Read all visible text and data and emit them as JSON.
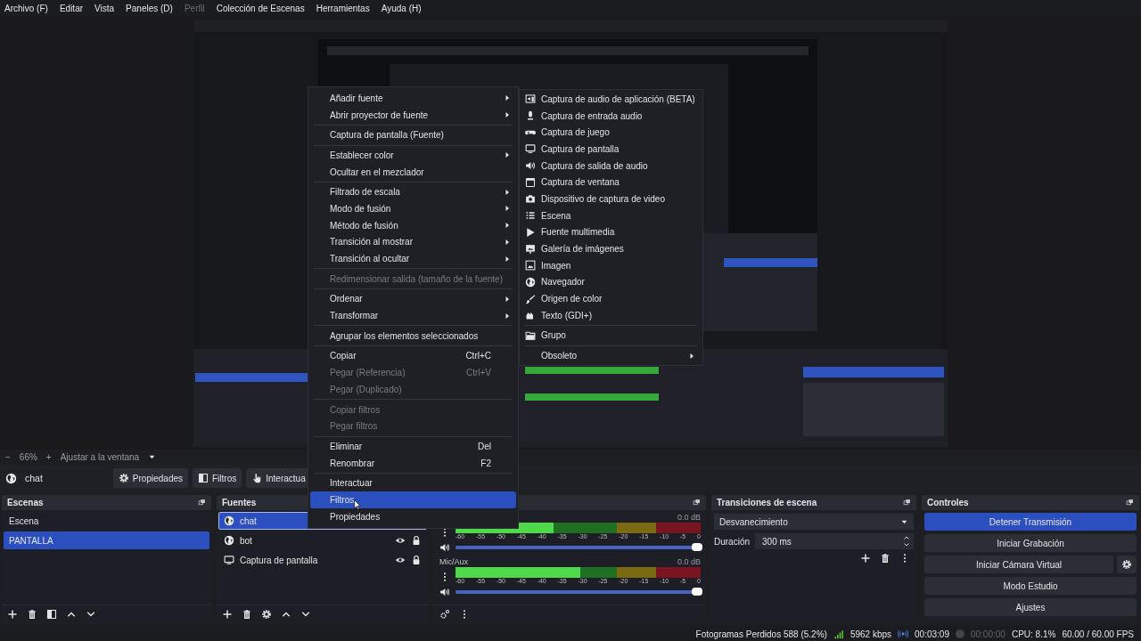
{
  "menu_bar": [
    {
      "label": "Archivo (F)",
      "disabled": false
    },
    {
      "label": "Editar",
      "disabled": false
    },
    {
      "label": "Vista",
      "disabled": false
    },
    {
      "label": "Paneles (D)",
      "disabled": false
    },
    {
      "label": "Perfil",
      "disabled": true
    },
    {
      "label": "Colección de Escenas",
      "disabled": false
    },
    {
      "label": "Herramientas",
      "disabled": false
    },
    {
      "label": "Ayuda (H)",
      "disabled": false
    }
  ],
  "zoom_bar": {
    "zoom_out": "−",
    "zoom": "66%",
    "zoom_in": "+",
    "fit": "Ajustar a la ventana"
  },
  "source_toolbar": {
    "source": "chat",
    "buttons": [
      {
        "label": "Propiedades",
        "kind": "gear"
      },
      {
        "label": "Filtros",
        "kind": "filter"
      },
      {
        "label": "Interactua",
        "kind": "hand"
      }
    ]
  },
  "scenes": {
    "title": "Escenas",
    "items": [
      {
        "label": "Escena",
        "selected": false
      },
      {
        "label": "PANTALLA",
        "selected": true
      }
    ]
  },
  "sources": {
    "title": "Fuentes",
    "items": [
      {
        "label": "chat",
        "kind": "browser",
        "selected": true
      },
      {
        "label": "bot",
        "kind": "browser",
        "selected": false,
        "visible": true,
        "locked": true
      },
      {
        "label": "Captura de pantalla",
        "kind": "display",
        "selected": false,
        "visible": true,
        "locked": true
      }
    ]
  },
  "mixer": {
    "channels": [
      {
        "reading": "0.0 dB",
        "meter": {
          "level": 0.4
        },
        "volume": {
          "level": 1
        },
        "scale": [
          "-60",
          "-55",
          "-50",
          "-45",
          "-40",
          "-35",
          "-30",
          "-25",
          "-20",
          "-15",
          "-10",
          "-5",
          "0"
        ]
      },
      {
        "name": "Mic/Aux",
        "reading": "0.0 dB",
        "meter": {
          "level": 0.51
        },
        "volume": {
          "level": 1
        },
        "scale": [
          "-60",
          "-55",
          "-50",
          "-45",
          "-40",
          "-35",
          "-30",
          "-25",
          "-20",
          "-15",
          "-10",
          "-5",
          "0"
        ]
      }
    ]
  },
  "transitions": {
    "title": "Transiciones de escena",
    "transition": "Desvanecimiento",
    "duration_label": "Duración",
    "duration": "300 ms"
  },
  "controls": {
    "title": "Controles",
    "buttons": [
      {
        "label": "Detener Transmisión",
        "active": true
      },
      {
        "label": "Iniciar Grabación",
        "active": false
      },
      {
        "label": "Iniciar Cámara Virtual",
        "active": false
      },
      {
        "label": "Modo Estudio",
        "active": false
      },
      {
        "label": "Ajustes",
        "active": false
      }
    ]
  },
  "status_bar": {
    "dropped": "Fotogramas Perdidos 588 (5.2%)",
    "bitrate": "5962 kbps",
    "stream_time": "00:03:09",
    "record_time": "00:00:00",
    "recording": false,
    "cpu": "CPU: 8.1%",
    "fps": "60.00 / 60.00 FPS"
  },
  "context_menu": {
    "groups": [
      [
        {
          "label": "Añadir fuente",
          "submenu": true,
          "disabled": false,
          "selected": false
        },
        {
          "label": "Abrir proyector de fuente",
          "submenu": true,
          "disabled": false,
          "selected": false
        }
      ],
      [
        {
          "label": "Captura de pantalla (Fuente)",
          "submenu": false,
          "disabled": false,
          "selected": false
        }
      ],
      [
        {
          "label": "Establecer color",
          "submenu": true,
          "disabled": false,
          "selected": false
        },
        {
          "label": "Ocultar en el mezclador",
          "submenu": false,
          "disabled": false,
          "selected": false
        }
      ],
      [
        {
          "label": "Filtrado de escala",
          "submenu": true,
          "disabled": false,
          "selected": false
        },
        {
          "label": "Modo de fusión",
          "submenu": true,
          "disabled": false,
          "selected": false
        },
        {
          "label": "Método de fusión",
          "submenu": true,
          "disabled": false,
          "selected": false
        },
        {
          "label": "Transición al mostrar",
          "submenu": true,
          "disabled": false,
          "selected": false
        },
        {
          "label": "Transición al ocultar",
          "submenu": true,
          "disabled": false,
          "selected": false
        }
      ],
      [
        {
          "label": "Redimensionar salida (tamaño de la fuente)",
          "submenu": false,
          "disabled": true,
          "selected": false
        }
      ],
      [
        {
          "label": "Ordenar",
          "submenu": true,
          "disabled": false,
          "selected": false
        },
        {
          "label": "Transformar",
          "submenu": true,
          "disabled": false,
          "selected": false
        }
      ],
      [
        {
          "label": "Agrupar los elementos seleccionados",
          "submenu": false,
          "disabled": false,
          "selected": false
        }
      ],
      [
        {
          "label": "Copiar",
          "shortcut": "Ctrl+C",
          "submenu": false,
          "disabled": false,
          "selected": false
        },
        {
          "label": "Pegar (Referencia)",
          "shortcut": "Ctrl+V",
          "submenu": false,
          "disabled": true,
          "selected": false
        },
        {
          "label": "Pegar (Duplicado)",
          "submenu": false,
          "disabled": true,
          "selected": false
        }
      ],
      [
        {
          "label": "Copiar filtros",
          "submenu": false,
          "disabled": true,
          "selected": false
        },
        {
          "label": "Pegar filtros",
          "submenu": false,
          "disabled": true,
          "selected": false
        }
      ],
      [
        {
          "label": "Eliminar",
          "shortcut": "Del",
          "submenu": false,
          "disabled": false,
          "selected": false
        },
        {
          "label": "Renombrar",
          "shortcut": "F2",
          "submenu": false,
          "disabled": false,
          "selected": false
        }
      ],
      [
        {
          "label": "Interactuar",
          "submenu": false,
          "disabled": false,
          "selected": false
        },
        {
          "label": "Filtros",
          "submenu": false,
          "disabled": false,
          "selected": true
        },
        {
          "label": "Propiedades",
          "submenu": false,
          "disabled": false,
          "selected": false
        }
      ]
    ]
  },
  "add_source_submenu": {
    "groups": [
      [
        {
          "label": "Captura de audio de aplicación (BETA)",
          "kind": "source"
        },
        {
          "label": "Captura de entrada audio",
          "kind": "source"
        },
        {
          "label": "Captura de juego",
          "kind": "source"
        },
        {
          "label": "Captura de pantalla",
          "kind": "source"
        },
        {
          "label": "Captura de salida de audio",
          "kind": "source"
        },
        {
          "label": "Captura de ventana",
          "kind": "source"
        },
        {
          "label": "Dispositivo de captura de video",
          "kind": "source"
        },
        {
          "label": "Escena",
          "kind": "source"
        },
        {
          "label": "Fuente multimedia",
          "kind": "source"
        },
        {
          "label": "Galería de imágenes",
          "kind": "source"
        },
        {
          "label": "Imagen",
          "kind": "source"
        },
        {
          "label": "Navegador",
          "kind": "source"
        },
        {
          "label": "Origen de color",
          "kind": "source"
        },
        {
          "label": "Texto (GDI+)",
          "kind": "source"
        }
      ],
      [
        {
          "label": "Grupo",
          "kind": "source"
        }
      ],
      [
        {
          "label": "Obsoleto",
          "kind": "submenu"
        }
      ]
    ]
  }
}
